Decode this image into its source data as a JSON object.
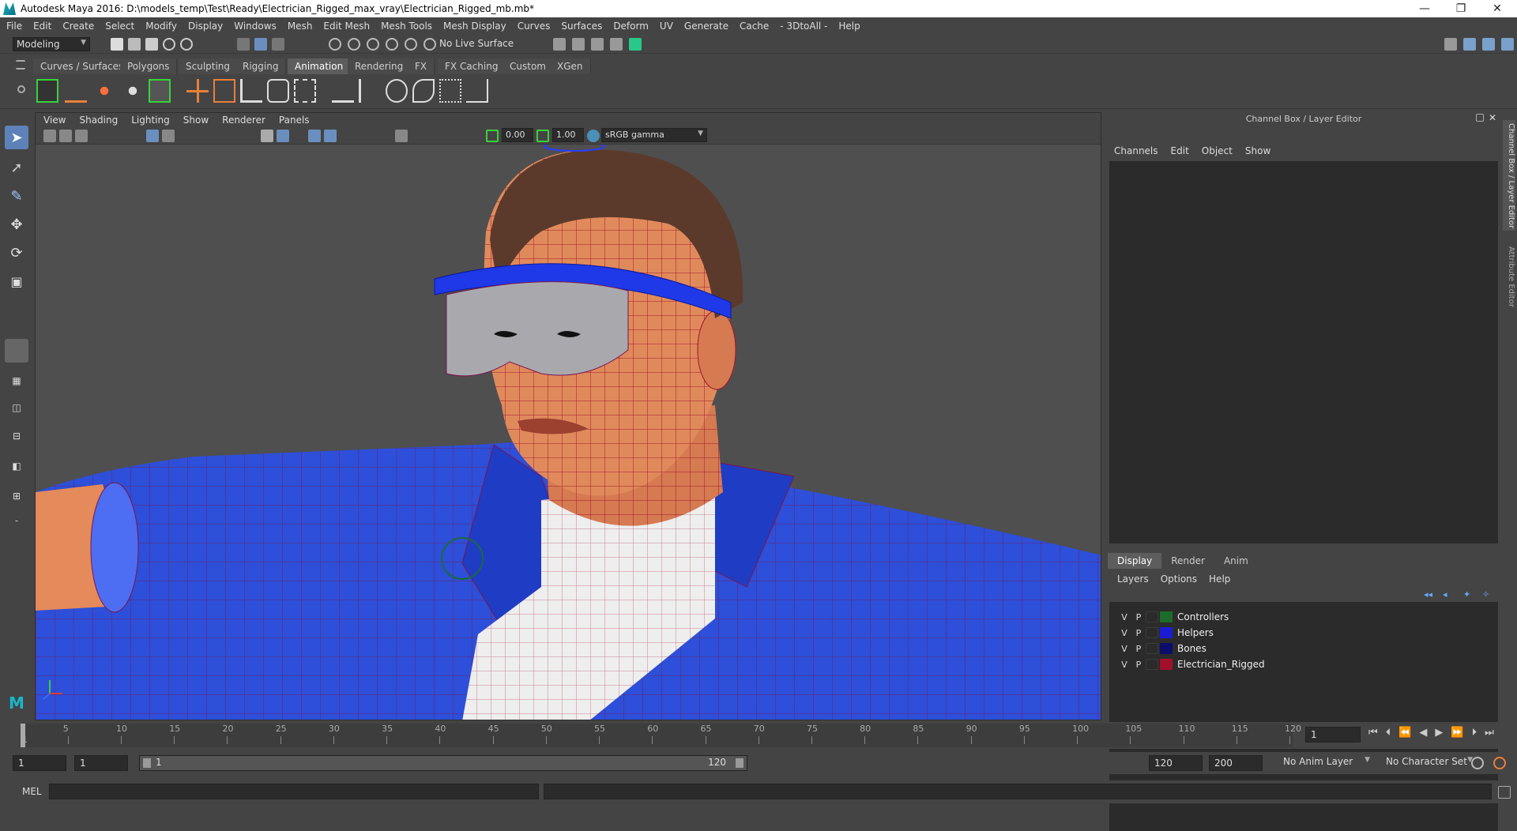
{
  "window": {
    "title": "Autodesk Maya 2016: D:\\models_temp\\Test\\Ready\\Electrician_Rigged_max_vray\\Electrician_Rigged_mb.mb*",
    "minimize_glyph": "—",
    "maximize_glyph": "❐",
    "close_glyph": "✕"
  },
  "menubar": [
    "File",
    "Edit",
    "Create",
    "Select",
    "Modify",
    "Display",
    "Windows",
    "Mesh",
    "Edit Mesh",
    "Mesh Tools",
    "Mesh Display",
    "Curves",
    "Surfaces",
    "Deform",
    "UV",
    "Generate",
    "Cache",
    "- 3DtoAll -",
    "Help"
  ],
  "statusline": {
    "mode": "Modeling",
    "live_surface": "No Live Surface"
  },
  "shelf_tabs": [
    "Curves / Surfaces",
    "Polygons",
    "Sculpting",
    "Rigging",
    "Animation",
    "Rendering",
    "FX",
    "FX Caching",
    "Custom",
    "XGen"
  ],
  "active_shelf_tab": "Animation",
  "viewport": {
    "menu": [
      "View",
      "Shading",
      "Lighting",
      "Show",
      "Renderer",
      "Panels"
    ],
    "exposure": "0.00",
    "gamma": "1.00",
    "color_space": "sRGB gamma"
  },
  "channel_box": {
    "title": "Channel Box / Layer Editor",
    "menu": [
      "Channels",
      "Edit",
      "Object",
      "Show"
    ]
  },
  "layer_editor": {
    "tabs": [
      "Display",
      "Render",
      "Anim"
    ],
    "active_tab": "Display",
    "menu": [
      "Layers",
      "Options",
      "Help"
    ],
    "layers": [
      {
        "v": "V",
        "p": "P",
        "name": "Controllers",
        "color": "#1d6b2a"
      },
      {
        "v": "V",
        "p": "P",
        "name": "Helpers",
        "color": "#1b1bd6"
      },
      {
        "v": "V",
        "p": "P",
        "name": "Bones",
        "color": "#0d0d6e"
      },
      {
        "v": "V",
        "p": "P",
        "name": "Electrician_Rigged",
        "color": "#a0102a"
      }
    ]
  },
  "side_tabs": [
    "Channel Box / Layer Editor",
    "Attribute Editor"
  ],
  "time_slider": {
    "ticks": [
      "5",
      "10",
      "15",
      "20",
      "25",
      "30",
      "35",
      "40",
      "45",
      "50",
      "55",
      "60",
      "65",
      "70",
      "75",
      "80",
      "85",
      "90",
      "95",
      "100",
      "105",
      "110",
      "115",
      "120"
    ],
    "start_label": "1",
    "current_frame": "1"
  },
  "range": {
    "start": "1",
    "playback_start": "1",
    "range_slider_start": "1",
    "range_slider_end": "120",
    "playback_end": "120",
    "end": "200",
    "anim_layer": "No Anim Layer",
    "character_set": "No Character Set"
  },
  "command_line": {
    "label": "MEL"
  },
  "icons": [
    "select-tool-icon",
    "lasso-tool-icon",
    "paint-select-icon",
    "move-tool-icon",
    "rotate-tool-icon",
    "scale-tool-icon",
    "play-forward-icon",
    "play-backward-icon",
    "step-forward-icon",
    "step-backward-icon",
    "go-to-start-icon",
    "go-to-end-icon"
  ]
}
